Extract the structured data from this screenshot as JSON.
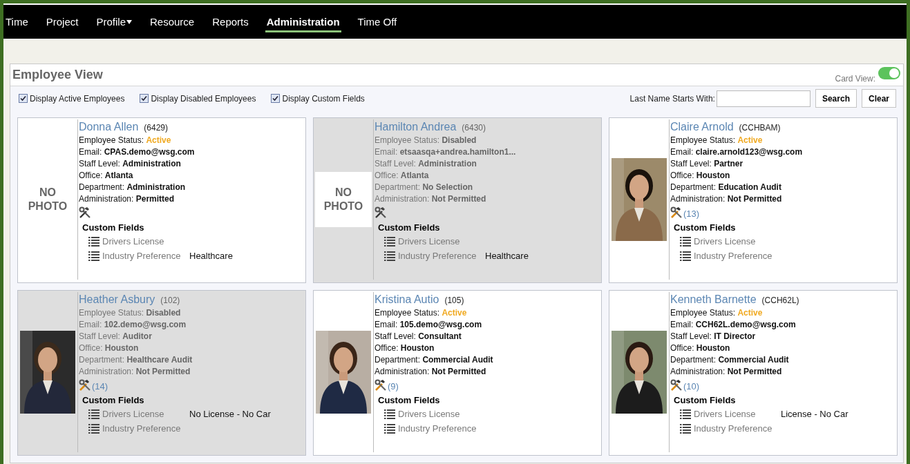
{
  "nav": [
    {
      "label": "Time",
      "selected": false,
      "has_menu": false
    },
    {
      "label": "Project",
      "selected": false,
      "has_menu": false
    },
    {
      "label": "Profile",
      "selected": false,
      "has_menu": true
    },
    {
      "label": "Resource",
      "selected": false,
      "has_menu": false
    },
    {
      "label": "Reports",
      "selected": false,
      "has_menu": false
    },
    {
      "label": "Administration",
      "selected": true,
      "has_menu": false
    },
    {
      "label": "Time Off",
      "selected": false,
      "has_menu": false
    }
  ],
  "panel": {
    "title": "Employee View",
    "card_view": {
      "label": "Card View:",
      "on": true
    },
    "filters": [
      {
        "label": "Display Active Employees",
        "checked": true
      },
      {
        "label": "Display Disabled Employees",
        "checked": true
      },
      {
        "label": "Display Custom Fields",
        "checked": true
      }
    ],
    "search": {
      "label": "Last Name Starts With:",
      "buttons": [
        "Search",
        "Clear"
      ]
    }
  },
  "employees": [
    {
      "name": "Donna Allen",
      "code": "(6429)",
      "photo": {
        "kind": "none",
        "text": "NO PHOTO"
      },
      "disabled": false,
      "status_label": "Employee Status:",
      "status": "Active",
      "details": [
        {
          "label": "Email:",
          "value": "CPAS.demo@wsg.com"
        },
        {
          "label": "Staff Level:",
          "value": "Administration"
        },
        {
          "label": "Office:",
          "value": "Atlanta"
        },
        {
          "label": "Department:",
          "value": "Administration"
        },
        {
          "label": "Administration:",
          "value": "Permitted"
        }
      ],
      "custom_title": "Custom Fields",
      "custom_fields": [
        {
          "label": "Drivers License"
        },
        {
          "label": "Industry Preference",
          "value": "Healthcare"
        }
      ]
    },
    {
      "name": "Hamilton Andrea",
      "code": "(6430)",
      "photo": {
        "kind": "none",
        "text": "NO PHOTO"
      },
      "disabled": true,
      "status_label": "Employee Status:",
      "status": "Disabled",
      "details": [
        {
          "label": "Email:",
          "value": "etsaasqa+andrea.hamilton1..."
        },
        {
          "label": "Staff Level:",
          "value": "Administration"
        },
        {
          "label": "Office:",
          "value": "Atlanta"
        },
        {
          "label": "Department:",
          "value": "No Selection"
        },
        {
          "label": "Administration:",
          "value": "Not Permitted"
        }
      ],
      "custom_title": "Custom Fields",
      "custom_fields": [
        {
          "label": "Drivers License"
        },
        {
          "label": "Industry Preference",
          "value": "Healthcare"
        }
      ]
    },
    {
      "name": "Claire Arnold",
      "code": "(CCHBAM)",
      "photo": {
        "kind": "picture"
      },
      "disabled": false,
      "status_label": "Employee Status:",
      "status": "Active",
      "details": [
        {
          "label": "Email:",
          "value": "claire.arnold123@wsg.com"
        },
        {
          "label": "Staff Level:",
          "value": "Partner"
        },
        {
          "label": "Office:",
          "value": "Houston"
        },
        {
          "label": "Department:",
          "value": "Education Audit"
        },
        {
          "label": "Administration:",
          "value": "Not Permitted"
        }
      ],
      "tools_count": "(13)",
      "custom_title": "Custom Fields",
      "custom_fields": [
        {
          "label": "Drivers License"
        },
        {
          "label": "Industry Preference"
        }
      ]
    },
    {
      "name": "Heather Asbury",
      "code": "(102)",
      "photo": {
        "kind": "picture"
      },
      "disabled": true,
      "status_label": "Employee Status:",
      "status": "Disabled",
      "details": [
        {
          "label": "Email:",
          "value": "102.demo@wsg.com"
        },
        {
          "label": "Staff Level:",
          "value": "Auditor"
        },
        {
          "label": "Office:",
          "value": "Houston"
        },
        {
          "label": "Department:",
          "value": "Healthcare Audit"
        },
        {
          "label": "Administration:",
          "value": "Not Permitted"
        }
      ],
      "tools_count": "(14)",
      "custom_title": "Custom Fields",
      "custom_fields": [
        {
          "label": "Drivers License",
          "value": "No License - No Car"
        },
        {
          "label": "Industry Preference"
        }
      ]
    },
    {
      "name": "Kristina Autio",
      "code": "(105)",
      "photo": {
        "kind": "picture"
      },
      "disabled": false,
      "status_label": "Employee Status:",
      "status": "Active",
      "details": [
        {
          "label": "Email:",
          "value": "105.demo@wsg.com"
        },
        {
          "label": "Staff Level:",
          "value": "Consultant"
        },
        {
          "label": "Office:",
          "value": "Houston"
        },
        {
          "label": "Department:",
          "value": "Commercial Audit"
        },
        {
          "label": "Administration:",
          "value": "Not Permitted"
        }
      ],
      "tools_count": "(9)",
      "custom_title": "Custom Fields",
      "custom_fields": [
        {
          "label": "Drivers License"
        },
        {
          "label": "Industry Preference"
        }
      ]
    },
    {
      "name": "Kenneth Barnette",
      "code": "(CCH62L)",
      "photo": {
        "kind": "picture"
      },
      "disabled": false,
      "status_label": "Employee Status:",
      "status": "Active",
      "details": [
        {
          "label": "Email:",
          "value": "CCH62L.demo@wsg.com"
        },
        {
          "label": "Staff Level:",
          "value": "IT Director"
        },
        {
          "label": "Office:",
          "value": "Houston"
        },
        {
          "label": "Department:",
          "value": "Commercial Audit"
        },
        {
          "label": "Administration:",
          "value": "Not Permitted"
        }
      ],
      "tools_count": "(10)",
      "custom_title": "Custom Fields",
      "custom_fields": [
        {
          "label": "Drivers License",
          "value": "License - No Car"
        },
        {
          "label": "Industry Preference"
        }
      ]
    }
  ]
}
